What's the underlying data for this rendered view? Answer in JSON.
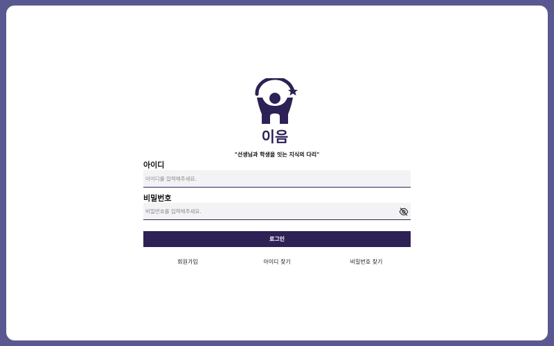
{
  "brand": {
    "logo_text": "이음",
    "slogan": "\"선생님과 학생을 잇는 지식의 다리\"",
    "colors": {
      "primary": "#2d2155",
      "background": "#5a5890",
      "card": "#ffffff"
    }
  },
  "form": {
    "id_label": "아이디",
    "id_placeholder": "아이디를 입력해주세요.",
    "password_label": "비밀번호",
    "password_placeholder": "비밀번호를 입력해주세요.",
    "password_toggle_icon": "eye-off-icon",
    "login_label": "로그인"
  },
  "links": {
    "signup": "회원가입",
    "find_id": "아이디 찾기",
    "find_password": "비밀번호 찾기"
  }
}
